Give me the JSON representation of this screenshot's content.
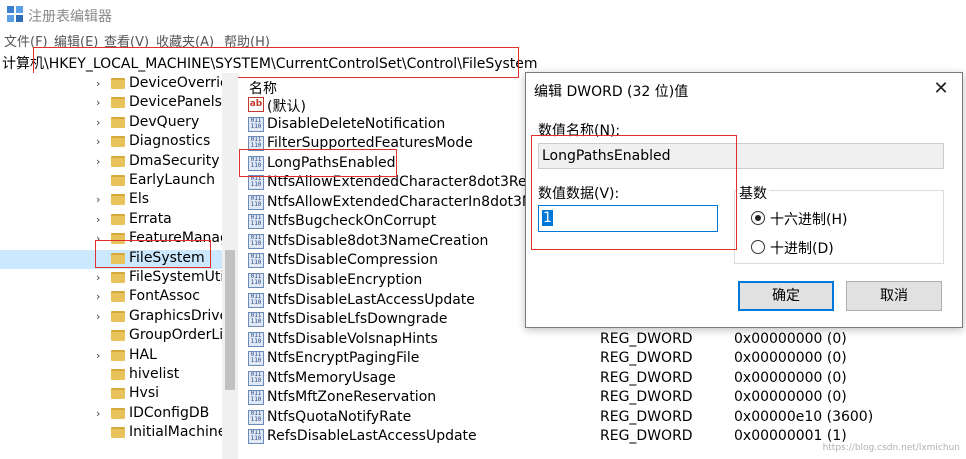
{
  "window": {
    "title": "注册表编辑器",
    "icon": "regedit-icon"
  },
  "menu": [
    "文件(F)",
    "编辑(E)",
    "查看(V)",
    "收藏夹(A)",
    "帮助(H)"
  ],
  "address": {
    "path": "计算机\\HKEY_LOCAL_MACHINE\\SYSTEM\\CurrentControlSet\\Control\\FileSystem"
  },
  "tree": {
    "items": [
      {
        "label": "DeviceOverrid",
        "expandable": true
      },
      {
        "label": "DevicePanels",
        "expandable": true
      },
      {
        "label": "DevQuery",
        "expandable": true
      },
      {
        "label": "Diagnostics",
        "expandable": true
      },
      {
        "label": "DmaSecurity",
        "expandable": true
      },
      {
        "label": "EarlyLaunch",
        "expandable": false
      },
      {
        "label": "Els",
        "expandable": true
      },
      {
        "label": "Errata",
        "expandable": true
      },
      {
        "label": "FeatureManag",
        "expandable": true
      },
      {
        "label": "FileSystem",
        "expandable": false,
        "selected": true
      },
      {
        "label": "FileSystemUtil",
        "expandable": true
      },
      {
        "label": "FontAssoc",
        "expandable": true
      },
      {
        "label": "GraphicsDriver",
        "expandable": true
      },
      {
        "label": "GroupOrderLis",
        "expandable": false
      },
      {
        "label": "HAL",
        "expandable": true
      },
      {
        "label": "hivelist",
        "expandable": false
      },
      {
        "label": "Hvsi",
        "expandable": false
      },
      {
        "label": "IDConfigDB",
        "expandable": true
      },
      {
        "label": "InitialMachine",
        "expandable": false
      }
    ]
  },
  "values": {
    "column_name": "名称",
    "rows": [
      {
        "name": "(默认)",
        "type": "",
        "data": "",
        "kind": "string"
      },
      {
        "name": "DisableDeleteNotification",
        "type": "",
        "data": "",
        "kind": "dword"
      },
      {
        "name": "FilterSupportedFeaturesMode",
        "type": "",
        "data": "",
        "kind": "dword"
      },
      {
        "name": "LongPathsEnabled",
        "type": "",
        "data": "",
        "kind": "dword"
      },
      {
        "name": "NtfsAllowExtendedCharacter8dot3Renar",
        "type": "",
        "data": "",
        "kind": "dword"
      },
      {
        "name": "NtfsAllowExtendedCharacterIn8dot3Nam",
        "type": "",
        "data": "",
        "kind": "dword"
      },
      {
        "name": "NtfsBugcheckOnCorrupt",
        "type": "",
        "data": "",
        "kind": "dword"
      },
      {
        "name": "NtfsDisable8dot3NameCreation",
        "type": "",
        "data": "",
        "kind": "dword"
      },
      {
        "name": "NtfsDisableCompression",
        "type": "",
        "data": "",
        "kind": "dword"
      },
      {
        "name": "NtfsDisableEncryption",
        "type": "",
        "data": "",
        "kind": "dword"
      },
      {
        "name": "NtfsDisableLastAccessUpdate",
        "type": "",
        "data": "",
        "kind": "dword"
      },
      {
        "name": "NtfsDisableLfsDowngrade",
        "type": "",
        "data": "",
        "kind": "dword"
      },
      {
        "name": "NtfsDisableVolsnapHints",
        "type": "REG_DWORD",
        "data": "0x00000000 (0)",
        "kind": "dword"
      },
      {
        "name": "NtfsEncryptPagingFile",
        "type": "REG_DWORD",
        "data": "0x00000000 (0)",
        "kind": "dword"
      },
      {
        "name": "NtfsMemoryUsage",
        "type": "REG_DWORD",
        "data": "0x00000000 (0)",
        "kind": "dword"
      },
      {
        "name": "NtfsMftZoneReservation",
        "type": "REG_DWORD",
        "data": "0x00000000 (0)",
        "kind": "dword"
      },
      {
        "name": "NtfsQuotaNotifyRate",
        "type": "REG_DWORD",
        "data": "0x00000e10 (3600)",
        "kind": "dword"
      },
      {
        "name": "RefsDisableLastAccessUpdate",
        "type": "REG_DWORD",
        "data": "0x00000001 (1)",
        "kind": "dword"
      }
    ]
  },
  "dialog": {
    "title": "编辑 DWORD (32 位)值",
    "value_name_label": "数值名称(N):",
    "value_name": "LongPathsEnabled",
    "value_data_label": "数值数据(V):",
    "value_data": "1",
    "base_label": "基数",
    "radio_hex": "十六进制(H)",
    "radio_dec": "十进制(D)",
    "selected_base": "hex",
    "ok_label": "确定",
    "cancel_label": "取消"
  },
  "watermark": "https://blog.csdn.net/lxmichun"
}
